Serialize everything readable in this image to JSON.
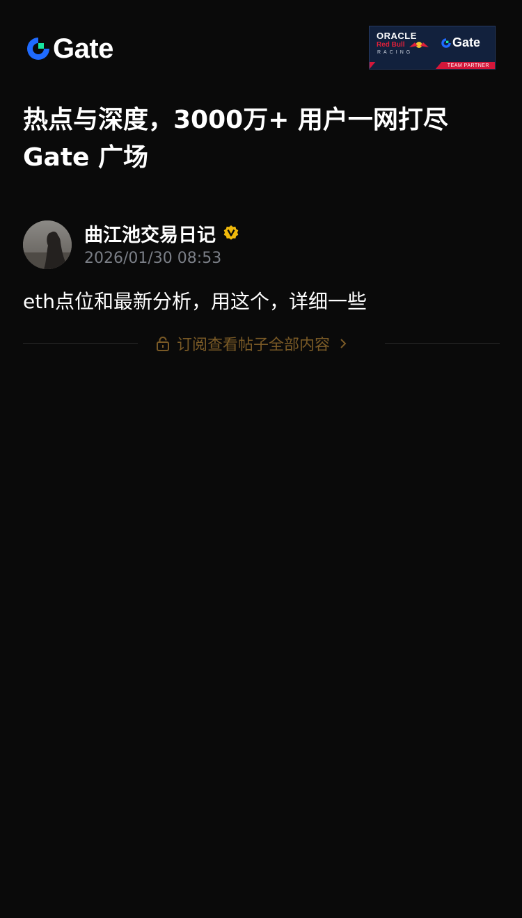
{
  "header": {
    "logo_text": "Gate",
    "partner_badge": {
      "line1": "ORACLE",
      "line2": "Red Bull",
      "line3": "RACING",
      "gate_text": "Gate",
      "tag": "TEAM PARTNER"
    }
  },
  "headline": {
    "line1": "热点与深度，3000万+ 用户一网打尽",
    "line2": "Gate 广场"
  },
  "post": {
    "author": "曲江池交易日记",
    "time": "2026/01/30 08:53",
    "content": "eth点位和最新分析，用这个，详细一些",
    "subscribe_label": "订阅查看帖子全部内容"
  },
  "colors": {
    "background": "#0a0a0a",
    "brand_blue": "#1f6bff",
    "brand_green": "#17e6a1",
    "verified_gold": "#f0b90b",
    "subscribe_brown": "#7a5a26"
  },
  "icons": {
    "verified": "verified-badge-icon",
    "lock": "lock-icon",
    "chevron": "chevron-right-icon"
  }
}
